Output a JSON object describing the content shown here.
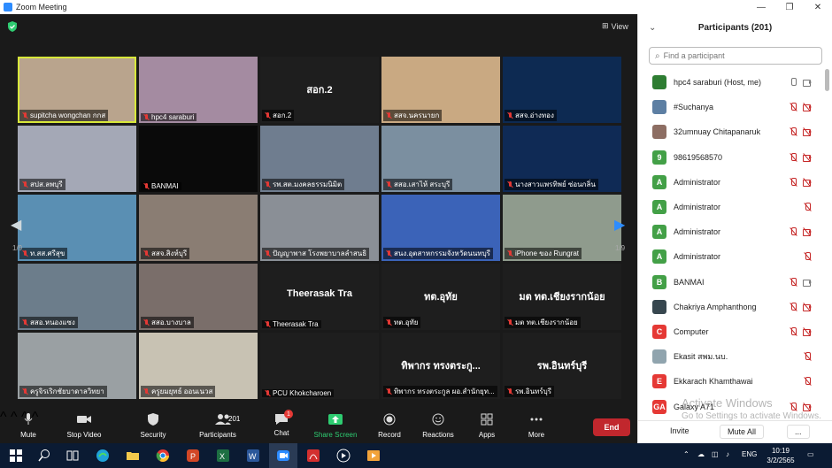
{
  "window": {
    "title": "Zoom Meeting",
    "controls": [
      "—",
      "❐",
      "✕"
    ]
  },
  "video": {
    "view_label": "View",
    "page_left": "1/9",
    "page_right": "1/9",
    "tiles": [
      {
        "name": "supitcha wongchan กกส",
        "bg": "#b9a48d",
        "active": true,
        "big": ""
      },
      {
        "name": "hpc4 saraburi",
        "bg": "#a48ba1",
        "active": false,
        "big": ""
      },
      {
        "name": "สอก.2",
        "bg": "#1e1e1e",
        "active": false,
        "big": "สอก.2"
      },
      {
        "name": "สสจ.นครนายก",
        "bg": "#c9a982",
        "active": false,
        "big": ""
      },
      {
        "name": "สสจ.อ่างทอง",
        "bg": "#0d2a52",
        "active": false,
        "big": ""
      },
      {
        "name": "สปส.ลพบุรี",
        "bg": "#a4a8b6",
        "active": false,
        "big": ""
      },
      {
        "name": "BANMAI",
        "bg": "#0a0a0a",
        "active": false,
        "big": ""
      },
      {
        "name": "รพ.สต.มงคลธรรมนิมิต",
        "bg": "#6f7d8f",
        "active": false,
        "big": ""
      },
      {
        "name": "สสอ.เสาไห้ สระบุรี",
        "bg": "#7b8fa0",
        "active": false,
        "big": ""
      },
      {
        "name": "นางสาวแพรทิพย์ ซ่อนกลิ่น",
        "bg": "#0f2a55",
        "active": false,
        "big": ""
      },
      {
        "name": "ท.สส.ศรีสุข",
        "bg": "#5a8fb3",
        "active": false,
        "big": ""
      },
      {
        "name": "สสจ.สิงห์บุรี",
        "bg": "#8a7d73",
        "active": false,
        "big": ""
      },
      {
        "name": "ปัญญาพาส โรงพยาบาลลำสนธิ",
        "bg": "#8a8f96",
        "active": false,
        "big": ""
      },
      {
        "name": "สนง.อุตสาหกรรมจังหวัดนนทบุรี",
        "bg": "#3b63b8",
        "active": false,
        "big": ""
      },
      {
        "name": "iPhone ของ Rungrat",
        "bg": "#8f9b8d",
        "active": false,
        "big": ""
      },
      {
        "name": "สสอ.หนองแซง",
        "bg": "#6c7d8b",
        "active": false,
        "big": ""
      },
      {
        "name": "สสอ.บางบาล",
        "bg": "#7a6e6a",
        "active": false,
        "big": ""
      },
      {
        "name": "Theerasak Tra",
        "bg": "#1e1e1e",
        "active": false,
        "big": "Theerasak Tra"
      },
      {
        "name": "ทต.อุทัย",
        "bg": "#1e1e1e",
        "active": false,
        "big": "ทต.อุทัย"
      },
      {
        "name": "มต ทต.เชียงรากน้อย",
        "bg": "#1e1e1e",
        "active": false,
        "big": "มต ทต.เชียงรากน้อย"
      },
      {
        "name": "ครูจิรเริกชัยบาดาลวิทยา",
        "bg": "#9aa0a3",
        "active": false,
        "big": ""
      },
      {
        "name": "ครูยมยุทธ์ ออนเนวส",
        "bg": "#c8c2b3",
        "active": false,
        "big": ""
      },
      {
        "name": "PCU Khokcharoen",
        "bg": "#1e1e1e",
        "active": false,
        "big": ""
      },
      {
        "name": "ทิพากร ทรงตระกูล ผอ.สำนักยุท...",
        "bg": "#1e1e1e",
        "active": false,
        "big": "ทิพากร ทรงตระกู..."
      },
      {
        "name": "รพ.อินทร์บุรี",
        "bg": "#1e1e1e",
        "active": false,
        "big": "รพ.อินทร์บุรี"
      }
    ]
  },
  "toolbar": {
    "mute": "Mute",
    "stop_video": "Stop Video",
    "security": "Security",
    "participants": "Participants",
    "participants_count": "201",
    "chat": "Chat",
    "chat_badge": "1",
    "share_screen": "Share Screen",
    "record": "Record",
    "reactions": "Reactions",
    "apps": "Apps",
    "more": "More",
    "end": "End"
  },
  "panel": {
    "title": "Participants (201)",
    "search_placeholder": "Find a participant",
    "participants": [
      {
        "name": "hpc4 saraburi (Host, me)",
        "avatar": "",
        "color": "#2e7d32",
        "mic": "on",
        "cam": "on"
      },
      {
        "name": "#Suchanya",
        "avatar": "",
        "color": "#5d7fa3",
        "mic": "off",
        "cam": "off"
      },
      {
        "name": "32umnuay Chitapanaruk",
        "avatar": "",
        "color": "#8d6e63",
        "mic": "off",
        "cam": "off"
      },
      {
        "name": "98619568570",
        "avatar": "9",
        "color": "#43a047",
        "mic": "off",
        "cam": "off"
      },
      {
        "name": "Administrator",
        "avatar": "A",
        "color": "#43a047",
        "mic": "off",
        "cam": "off"
      },
      {
        "name": "Administrator",
        "avatar": "A",
        "color": "#43a047",
        "mic": "off",
        "cam": "none"
      },
      {
        "name": "Administrator",
        "avatar": "A",
        "color": "#43a047",
        "mic": "off",
        "cam": "off"
      },
      {
        "name": "Administrator",
        "avatar": "A",
        "color": "#43a047",
        "mic": "off",
        "cam": "none"
      },
      {
        "name": "BANMAI",
        "avatar": "B",
        "color": "#43a047",
        "mic": "off",
        "cam": "on"
      },
      {
        "name": "Chakriya Amphanthong",
        "avatar": "",
        "color": "#37474f",
        "mic": "off",
        "cam": "off"
      },
      {
        "name": "Computer",
        "avatar": "C",
        "color": "#e53935",
        "mic": "off",
        "cam": "off"
      },
      {
        "name": "Ekasit สพม.นบ.",
        "avatar": "",
        "color": "#90a4ae",
        "mic": "off",
        "cam": "none"
      },
      {
        "name": "Ekkarach Khamthawai",
        "avatar": "E",
        "color": "#e53935",
        "mic": "off",
        "cam": "none"
      },
      {
        "name": "Galaxy A71",
        "avatar": "GA",
        "color": "#e53935",
        "mic": "off",
        "cam": "off"
      }
    ],
    "invite": "Invite",
    "mute_all": "Mute All",
    "more": "..."
  },
  "watermark": {
    "line1": "Activate Windows",
    "line2": "Go to Settings to activate Windows."
  },
  "taskbar": {
    "lang": "ENG",
    "time": "10:19",
    "date": "3/2/2565"
  }
}
